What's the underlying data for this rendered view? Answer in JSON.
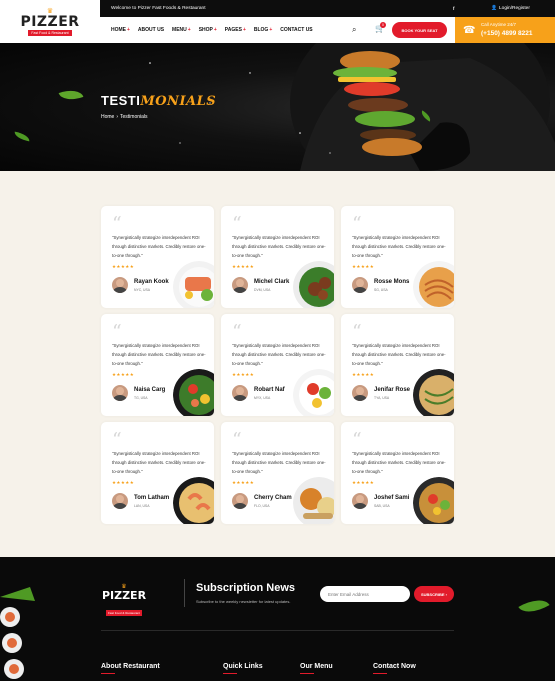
{
  "header": {
    "logo": {
      "text": "PIZZER",
      "tagline": "Fast Food & Restaurant"
    },
    "welcome": "Welcome to Pizzer Fast Foods & Restaurant",
    "social_icons": [
      "facebook-icon",
      "twitter-icon",
      "linkedin-icon",
      "instagram-icon"
    ],
    "social_glyphs": [
      "f",
      "t",
      "in",
      "◎"
    ],
    "login_label": "Login/Register",
    "nav": [
      {
        "label": "HOME",
        "has_sub": true
      },
      {
        "label": "ABOUT US",
        "has_sub": false
      },
      {
        "label": "MENU",
        "has_sub": true
      },
      {
        "label": "SHOP",
        "has_sub": true
      },
      {
        "label": "PAGES",
        "has_sub": true
      },
      {
        "label": "BLOG",
        "has_sub": true
      },
      {
        "label": "CONTACT US",
        "has_sub": false
      }
    ],
    "cart_count": "0",
    "book_button": "BOOK YOUR SEAT",
    "call_label": "Call Anytime 24/7",
    "call_number": "(+150) 4899 8221",
    "colors": {
      "accent": "#e21b2b",
      "secondary": "#f7a11a",
      "dark": "#0d0d0d"
    }
  },
  "hero": {
    "title_plain": "TESTI",
    "title_accent": "MONIALS",
    "breadcrumb_home": "Home",
    "breadcrumb_current": "Testimonials"
  },
  "testimonials": [
    {
      "name": "Rayan Kook",
      "location": "NYC, USA",
      "text": "\"Synergistically strategize interdependent ROI through distinctive markets. Credibly restore one-to-one through.\"",
      "stars": "★★★★★",
      "dish": "salmon"
    },
    {
      "name": "Michel Clark",
      "location": "DVM, USA",
      "text": "\"Synergistically strategize interdependent ROI through distinctive markets. Credibly restore one-to-one through.\"",
      "stars": "★★★★★",
      "dish": "meatball"
    },
    {
      "name": "Rosse Mons",
      "location": "SG, USA",
      "text": "\"Synergistically strategize interdependent ROI through distinctive markets. Credibly restore one-to-one through.\"",
      "stars": "★★★★★",
      "dish": "noodles"
    },
    {
      "name": "Naisa Carg",
      "location": "TG, USA",
      "text": "\"Synergistically strategize interdependent ROI through distinctive markets. Credibly restore one-to-one through.\"",
      "stars": "★★★★★",
      "dish": "bowl"
    },
    {
      "name": "Robart Naf",
      "location": "MYX, USA",
      "text": "\"Synergistically strategize interdependent ROI through distinctive markets. Credibly restore one-to-one through.\"",
      "stars": "★★★★★",
      "dish": "salad"
    },
    {
      "name": "Jenifar Rose",
      "location": "TYA, USA",
      "text": "\"Synergistically strategize interdependent ROI through distinctive markets. Credibly restore one-to-one through.\"",
      "stars": "★★★★★",
      "dish": "pasta"
    },
    {
      "name": "Tom Latham",
      "location": "LAN, USA",
      "text": "\"Synergistically strategize interdependent ROI through distinctive markets. Credibly restore one-to-one through.\"",
      "stars": "★★★★★",
      "dish": "shrimp"
    },
    {
      "name": "Cherry Cham",
      "location": "FLO, USA",
      "text": "\"Synergistically strategize interdependent ROI through distinctive markets. Credibly restore one-to-one through.\"",
      "stars": "★★★★★",
      "dish": "curry"
    },
    {
      "name": "Joshef Sami",
      "location": "SAB, USA",
      "text": "\"Synergistically strategize interdependent ROI through distinctive markets. Credibly restore one-to-one through.\"",
      "stars": "★★★★★",
      "dish": "stirfry"
    }
  ],
  "footer": {
    "logo": {
      "text": "PIZZER",
      "tagline": "Fast Food & Restaurant"
    },
    "subscription_title": "Subscription News",
    "subscription_desc": "Subscribe to the weekly newsletter for latest updates.",
    "email_placeholder": "Enter Email Address",
    "subscribe_button": "SUBSCRIBE",
    "columns": [
      "About Restaurant",
      "Quick Links",
      "Our Menu",
      "Contact Now"
    ]
  }
}
